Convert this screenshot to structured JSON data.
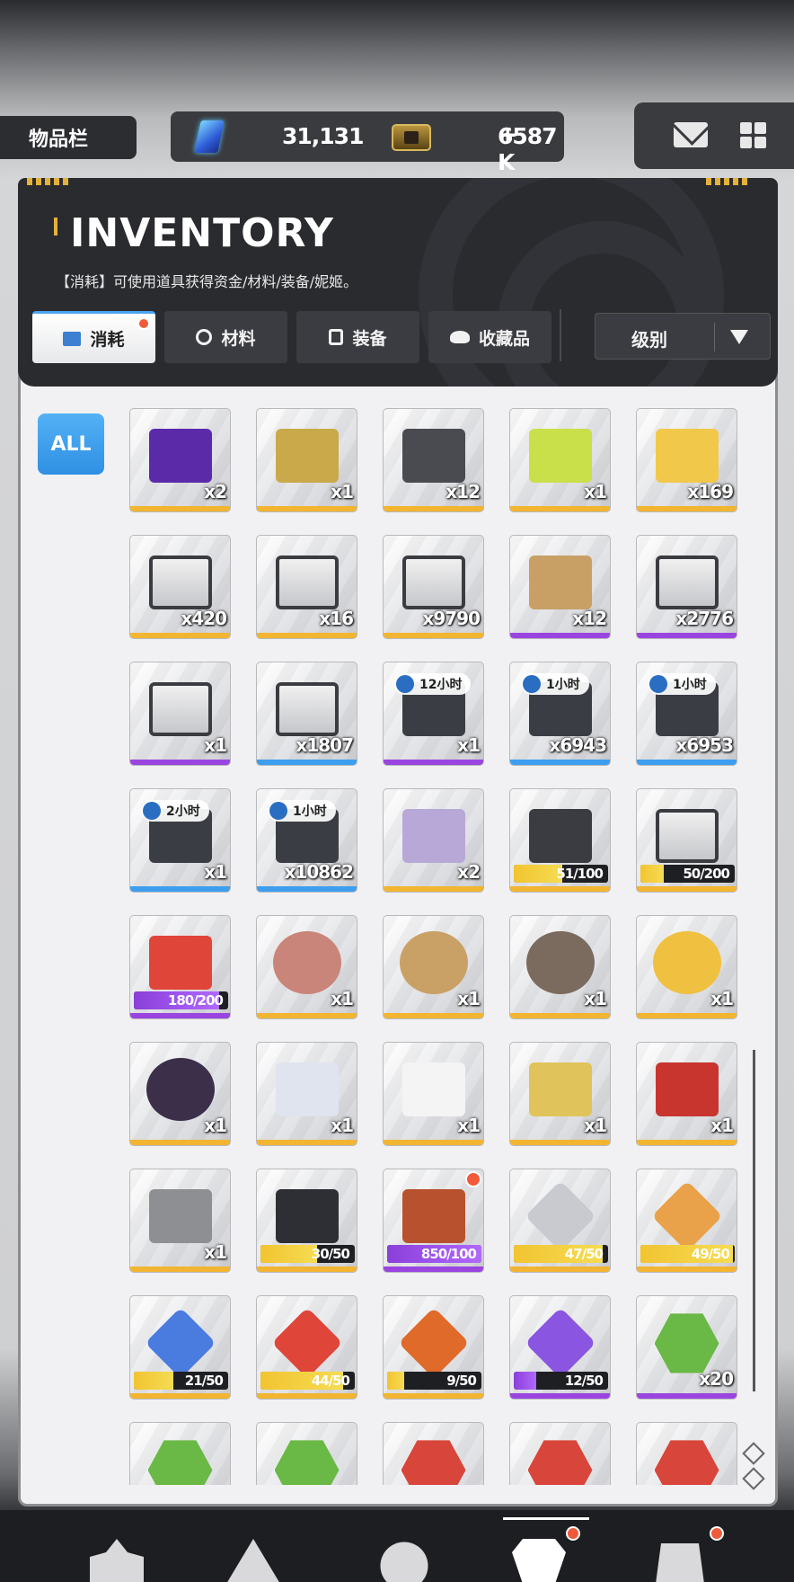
{
  "page_label": "物品栏",
  "currencies": {
    "gem": {
      "icon": "crystal-icon",
      "value": "31,131",
      "add_label": "+"
    },
    "gold": {
      "icon": "credit-card-icon",
      "value": "6587 K"
    }
  },
  "header": {
    "title": "INVENTORY",
    "description": "【消耗】可使用道具获得资金/材料/装备/妮姬。"
  },
  "tabs": [
    {
      "label": "消耗",
      "icon": "consumable-icon",
      "active": true,
      "badge": true
    },
    {
      "label": "材料",
      "icon": "material-icon",
      "active": false
    },
    {
      "label": "装备",
      "icon": "equipment-icon",
      "active": false
    },
    {
      "label": "收藏品",
      "icon": "collection-icon",
      "active": false
    }
  ],
  "sort": {
    "label": "级别"
  },
  "filter": {
    "all_label": "ALL"
  },
  "colors": {
    "accent": "#3d9ef0",
    "gold": "#f2b531",
    "purple": "#9a45e0",
    "badge": "#f05a3a",
    "panel_dark": "#2a2b2f"
  },
  "items": [
    {
      "name": "2nd-anniversary-gift-icon",
      "qty": "x2",
      "rarity": "gold",
      "art": "#5b2aa8"
    },
    {
      "name": "ssr-pyramid-box-icon",
      "qty": "x1",
      "rarity": "gold",
      "art": "#c9a94a"
    },
    {
      "name": "black-supply-chest-icon",
      "qty": "x12",
      "rarity": "gold",
      "art": "#4a4b50"
    },
    {
      "name": "yellow-capsule-icon",
      "qty": "x1",
      "rarity": "gold",
      "art": "#c9e04a"
    },
    {
      "name": "gold-supply-chest-icon",
      "qty": "x169",
      "rarity": "gold",
      "art": "#f2c84a"
    },
    {
      "name": "orange-crate-icon",
      "qty": "x420",
      "rarity": "gold",
      "art": "box"
    },
    {
      "name": "orange-crate-icon",
      "qty": "x16",
      "rarity": "gold",
      "art": "box"
    },
    {
      "name": "orange-crate-icon",
      "qty": "x9790",
      "rarity": "gold",
      "art": "box"
    },
    {
      "name": "cardboard-box-icon",
      "qty": "x12",
      "rarity": "purple",
      "art": "#c8a066"
    },
    {
      "name": "blue-crate-icon",
      "qty": "x2776",
      "rarity": "purple",
      "art": "box"
    },
    {
      "name": "green-crate-icon",
      "qty": "x1",
      "rarity": "purple",
      "art": "box"
    },
    {
      "name": "blue-crate-icon",
      "qty": "x1807",
      "rarity": "blue",
      "art": "box"
    },
    {
      "name": "case-icon",
      "qty": "x1",
      "rarity": "purple",
      "art": "#3a3d44",
      "timer": "12小时"
    },
    {
      "name": "case-icon",
      "qty": "x6943",
      "rarity": "blue",
      "art": "#3a3d44",
      "timer": "1小时"
    },
    {
      "name": "case-icon",
      "qty": "x6953",
      "rarity": "blue",
      "art": "#3a3d44",
      "timer": "1小时"
    },
    {
      "name": "case-icon",
      "qty": "x1",
      "rarity": "blue",
      "art": "#3a3d44",
      "timer": "2小时"
    },
    {
      "name": "case-icon",
      "qty": "x10862",
      "rarity": "blue",
      "art": "#3a3d44",
      "timer": "1小时"
    },
    {
      "name": "stickers-icon",
      "qty": "x2",
      "rarity": "gold",
      "art": "#b7a8d8"
    },
    {
      "name": "gold-emblem-chest-icon",
      "rarity": "gold",
      "art": "#3b3c41",
      "progress": "51/100",
      "progress_value": 0.51
    },
    {
      "name": "steel-crate-icon",
      "rarity": "gold",
      "art": "#8e8f93",
      "progress": "50/200",
      "progress_value": 0.25
    },
    {
      "name": "lucky-box-icon",
      "rarity": "purple",
      "art": "#e0453a",
      "progress": "180/200",
      "progress_value": 0.9,
      "progress_color": "purple"
    },
    {
      "name": "cake-icon",
      "qty": "x1",
      "rarity": "gold",
      "art": "#c9857a"
    },
    {
      "name": "shark-medal-icon",
      "qty": "x1",
      "rarity": "gold",
      "art": "#c9a066"
    },
    {
      "name": "anniversary-cake-icon",
      "qty": "x1",
      "rarity": "gold",
      "art": "#7b6a5e"
    },
    {
      "name": "omelette-icon",
      "qty": "x1",
      "rarity": "gold",
      "art": "#f0c040"
    },
    {
      "name": "stew-pot-icon",
      "qty": "x1",
      "rarity": "gold",
      "art": "#3b2f4a"
    },
    {
      "name": "keychain-icon",
      "qty": "x1",
      "rarity": "gold",
      "art": "#dfe4ee"
    },
    {
      "name": "drawing-note-icon",
      "qty": "x1",
      "rarity": "gold",
      "art": "#f4f4f4"
    },
    {
      "name": "gold-can-icon",
      "qty": "x1",
      "rarity": "gold",
      "art": "#e0c35a"
    },
    {
      "name": "chef-book-icon",
      "qty": "x1",
      "rarity": "gold",
      "art": "#c8352e"
    },
    {
      "name": "stone-figure-icon",
      "qty": "x1",
      "rarity": "gold",
      "art": "#8e8f93"
    },
    {
      "name": "black-card-icon",
      "rarity": "gold",
      "art": "#2e2f34",
      "progress": "30/50",
      "progress_value": 0.6
    },
    {
      "name": "backpack-icon",
      "rarity": "purple",
      "art": "#b8522e",
      "progress": "850/100",
      "progress_value": 1.0,
      "progress_color": "purple",
      "badge": true
    },
    {
      "name": "silver-shard-icon",
      "rarity": "gold",
      "art": "#c9cacf",
      "progress": "47/50",
      "progress_value": 0.94
    },
    {
      "name": "gold-shard-icon",
      "rarity": "gold",
      "art": "#e9a24a",
      "progress": "49/50",
      "progress_value": 0.98
    },
    {
      "name": "blue-shard-icon",
      "rarity": "gold",
      "art": "#4a7ce0",
      "progress": "21/50",
      "progress_value": 0.42
    },
    {
      "name": "red-shard-icon",
      "rarity": "gold",
      "art": "#e0453a",
      "progress": "44/50",
      "progress_value": 0.88
    },
    {
      "name": "fire-shard-icon",
      "rarity": "gold",
      "art": "#e06a2a",
      "progress": "9/50",
      "progress_value": 0.18
    },
    {
      "name": "purple-shard-icon",
      "rarity": "purple",
      "art": "#8a55e0",
      "progress": "12/50",
      "progress_value": 0.24,
      "progress_color": "purple"
    },
    {
      "name": "green-hex-module-icon",
      "qty": "x20",
      "rarity": "purple",
      "art": "#6ab845"
    },
    {
      "name": "green-hex-module-icon",
      "rarity": "gold",
      "art": "#6ab845"
    },
    {
      "name": "green-hex-module-icon",
      "rarity": "gold",
      "art": "#6ab845"
    },
    {
      "name": "red-hex-module-icon",
      "rarity": "gold",
      "art": "#d8453a"
    },
    {
      "name": "red-hex-module-icon",
      "rarity": "gold",
      "art": "#d8453a"
    },
    {
      "name": "red-hex-module-icon",
      "rarity": "gold",
      "art": "#d8453a"
    }
  ],
  "bottom_nav": [
    {
      "icon": "squad-icon"
    },
    {
      "icon": "outpost-icon"
    },
    {
      "icon": "globe-icon"
    },
    {
      "icon": "inventory-icon",
      "active": true,
      "badge": true
    },
    {
      "icon": "mission-icon",
      "badge": true
    }
  ]
}
